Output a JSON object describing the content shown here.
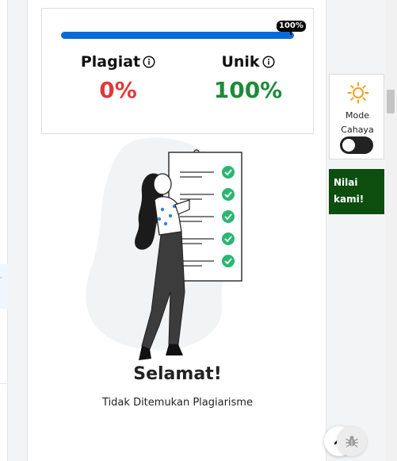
{
  "progress": {
    "label": "100%",
    "percent": 100
  },
  "metrics": {
    "plagiarism": {
      "label": "Plagiat",
      "value": "0%"
    },
    "unique": {
      "label": "Unik",
      "value": "100%"
    }
  },
  "result": {
    "title": "Selamat!",
    "subtitle": "Tidak Ditemukan Plagiarisme"
  },
  "theme": {
    "label_line1": "Mode",
    "label_line2": "Cahaya",
    "dark_mode_on": false
  },
  "rate": {
    "label_line1": "Nilai",
    "label_line2": "kami!"
  },
  "colors": {
    "progress_fill": "#0a6bd8",
    "plagiarism_value": "#dc3b3b",
    "unique_value": "#1e8a3a",
    "rate_bg": "#0d4e0f",
    "check_green": "#2bb673"
  },
  "icons": [
    "info-icon",
    "sun-icon",
    "chevron-up-icon",
    "bug-icon",
    "check-icon"
  ]
}
